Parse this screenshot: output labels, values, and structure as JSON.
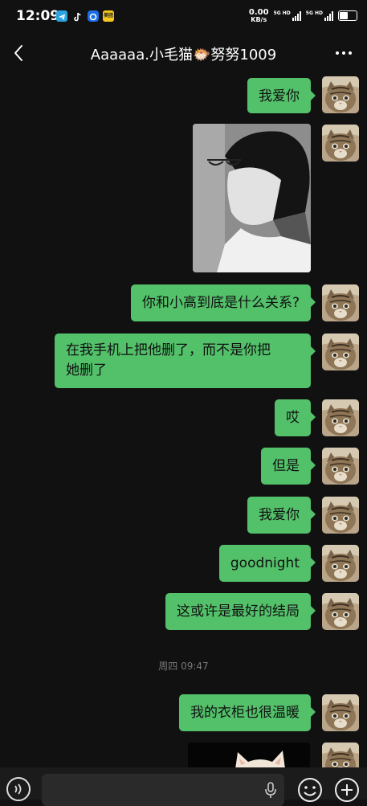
{
  "status_bar": {
    "time": "12:09",
    "net_speed_value": "0.00",
    "net_speed_unit": "KB/s",
    "sim1_label": "5G HD",
    "sim2_label": "5G HD",
    "battery_level": 0.6,
    "notification_icons": [
      "telegram-icon",
      "tiktok-icon",
      "browser-icon",
      "meituan-icon"
    ],
    "meituan_label": "美团"
  },
  "header": {
    "title": "Aaaaaa.小毛猫🐡努努1009"
  },
  "messages": [
    {
      "type": "text",
      "text": "我爱你"
    },
    {
      "type": "image",
      "description_icon": "photo-of-person"
    },
    {
      "type": "text",
      "text": "你和小高到底是什么关系?"
    },
    {
      "type": "text",
      "text_line1": "在我手机上把他删了，而不是你把",
      "text_line2": "她删了"
    },
    {
      "type": "text",
      "text": "哎"
    },
    {
      "type": "text",
      "text": "但是"
    },
    {
      "type": "text",
      "text": "我爱你"
    },
    {
      "type": "text",
      "text": "goodnight"
    },
    {
      "type": "text",
      "text": "这或许是最好的结局"
    },
    {
      "type": "text",
      "text": "我的衣柜也很温暖"
    },
    {
      "type": "image",
      "description_icon": "photo-of-cat"
    }
  ],
  "timestamp": "周四 09:47",
  "colors": {
    "bubble": "#53c06a",
    "background": "#111111"
  },
  "input_bar": {
    "icons": [
      "voice-icon",
      "microphone-icon",
      "emoji-icon",
      "plus-icon"
    ]
  }
}
